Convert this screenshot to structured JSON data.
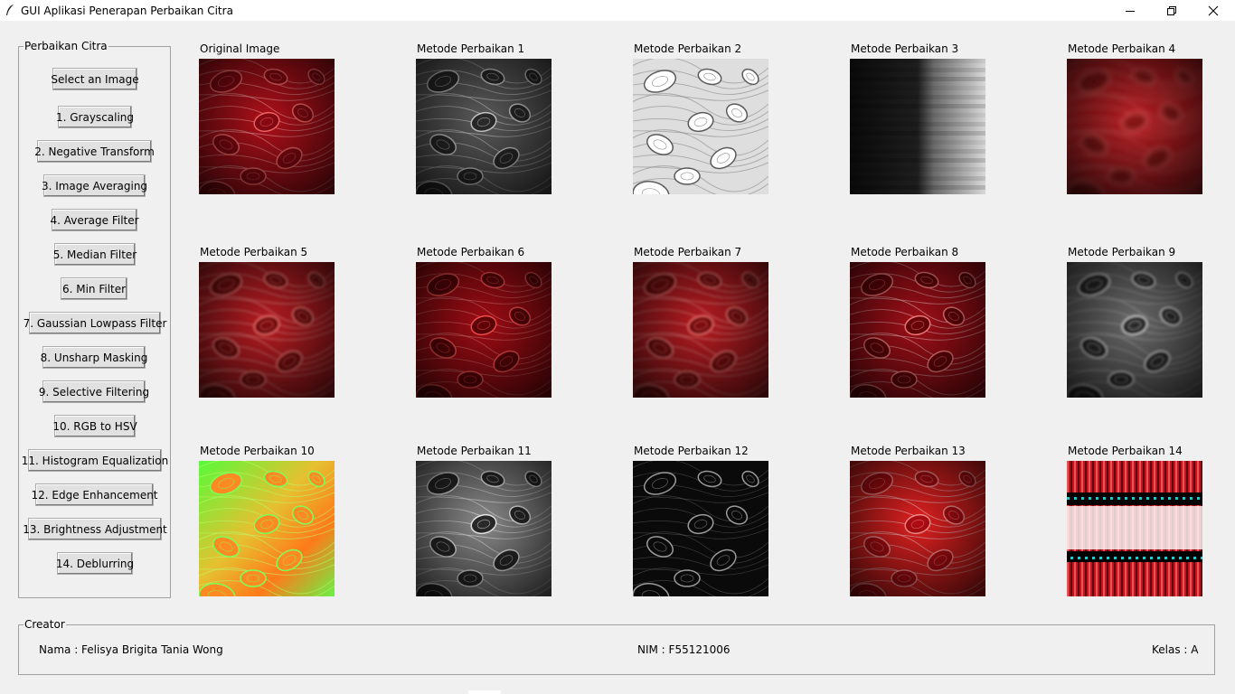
{
  "window": {
    "title": "GUI Aplikasi Penerapan Perbaikan Citra"
  },
  "sidebar": {
    "label": "Perbaikan Citra",
    "buttons": [
      "Select an Image",
      "1. Grayscaling",
      "2. Negative Transform",
      "3. Image Averaging",
      "4. Average Filter",
      "5. Median Filter",
      "6. Min Filter",
      "7. Gaussian Lowpass Filter",
      "8. Unsharp Masking",
      "9. Selective Filtering",
      "10. RGB to HSV",
      "11. Histogram Equalization",
      "12. Edge Enhancement",
      "13. Brightness Adjustment",
      "14. Deblurring"
    ]
  },
  "images": [
    {
      "label": "Original Image",
      "style": "red"
    },
    {
      "label": "Metode Perbaikan 1",
      "style": "gray"
    },
    {
      "label": "Metode Perbaikan 2",
      "style": "negative"
    },
    {
      "label": "Metode Perbaikan 3",
      "style": "bands"
    },
    {
      "label": "Metode Perbaikan 4",
      "style": "blur-red"
    },
    {
      "label": "Metode Perbaikan 5",
      "style": "red-soft"
    },
    {
      "label": "Metode Perbaikan 6",
      "style": "red-dark"
    },
    {
      "label": "Metode Perbaikan 7",
      "style": "red-soft"
    },
    {
      "label": "Metode Perbaikan 8",
      "style": "red-sharp"
    },
    {
      "label": "Metode Perbaikan 9",
      "style": "gray-blur"
    },
    {
      "label": "Metode Perbaikan 10",
      "style": "hsv"
    },
    {
      "label": "Metode Perbaikan 11",
      "style": "gray-eq"
    },
    {
      "label": "Metode Perbaikan 12",
      "style": "edges"
    },
    {
      "label": "Metode Perbaikan 13",
      "style": "red-bright"
    },
    {
      "label": "Metode Perbaikan 14",
      "style": "deblur"
    }
  ],
  "creator": {
    "label": "Creator",
    "name": "Nama : Felisya Brigita Tania Wong",
    "nim": "NIM : F55121006",
    "kelas": "Kelas : A"
  },
  "colors": {
    "background": "#f0f0f0",
    "button": "#e1e1e1",
    "border": "#a0a0a0"
  }
}
